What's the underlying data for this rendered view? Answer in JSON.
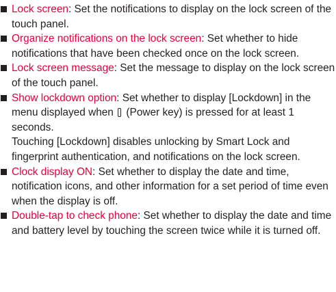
{
  "items": [
    {
      "term": "Lock screen",
      "text": ": Set the notifications to display on the lock screen of the touch panel."
    },
    {
      "term": "Organize notifications on the lock screen",
      "text": ": Set whether to hide notifications that have been checked once on the lock screen."
    },
    {
      "term": "Lock screen message",
      "text": ": Set the message to display on the lock screen of the touch panel."
    },
    {
      "term": "Show lockdown option",
      "text_before_icon": ": Set whether to display [Lockdown] in the menu displayed when ",
      "icon": "power-key-icon",
      "text_after_icon": " (Power key) is pressed for at least 1 seconds.",
      "note": "Touching [Lockdown] disables unlocking by Smart Lock and fingerprint authentication, and notifications on the lock screen."
    },
    {
      "term": "Clock display ON",
      "text": ": Set whether to display the date and time, notification icons, and other information for a set period of time even when the display is off."
    },
    {
      "term": "Double-tap to check phone",
      "text": ": Set whether to display the date and time and battery level by touching the screen twice while it is turned off."
    }
  ],
  "colors": {
    "term": "#e6003e",
    "body_text": "#231f20",
    "bullet": "#231f20"
  }
}
